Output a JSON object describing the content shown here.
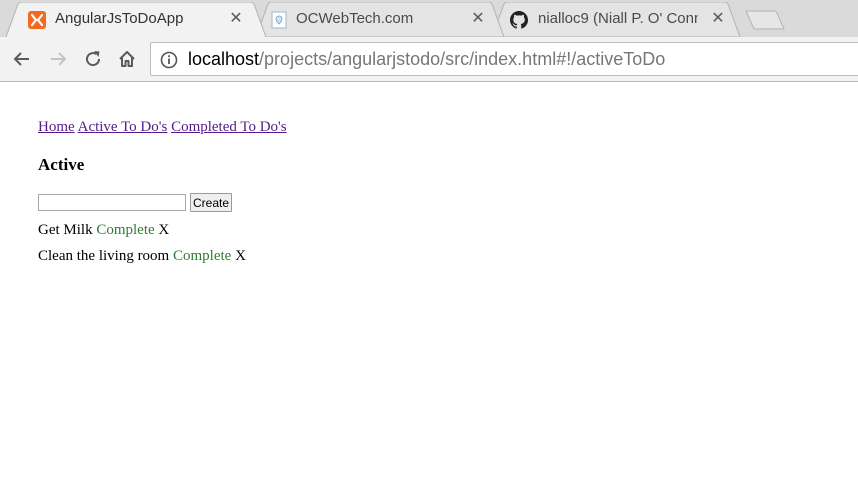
{
  "tabs": [
    {
      "title": "AngularJsToDoApp",
      "icon": "xampp-icon",
      "active": true
    },
    {
      "title": "OCWebTech.com",
      "icon": "page-icon",
      "active": false
    },
    {
      "title": "nialloc9 (Niall P. O' Conn",
      "icon": "github-icon",
      "active": false
    }
  ],
  "tab_close_glyph": "✕",
  "toolbar": {
    "url_host": "localhost",
    "url_path": "/projects/angularjstodo/src/index.html#!/activeToDo"
  },
  "page": {
    "nav": [
      "Home",
      "Active To Do's",
      "Completed To Do's"
    ],
    "heading": "Active",
    "input_value": "",
    "create_label": "Create",
    "todos": [
      {
        "text": "Get Milk",
        "complete_label": "Complete",
        "remove_label": "X"
      },
      {
        "text": "Clean the living room",
        "complete_label": "Complete",
        "remove_label": "X"
      }
    ]
  },
  "colors": {
    "link_visited": "#551a8b",
    "complete_green": "#2e7d32",
    "xampp_orange": "#f26b21"
  }
}
